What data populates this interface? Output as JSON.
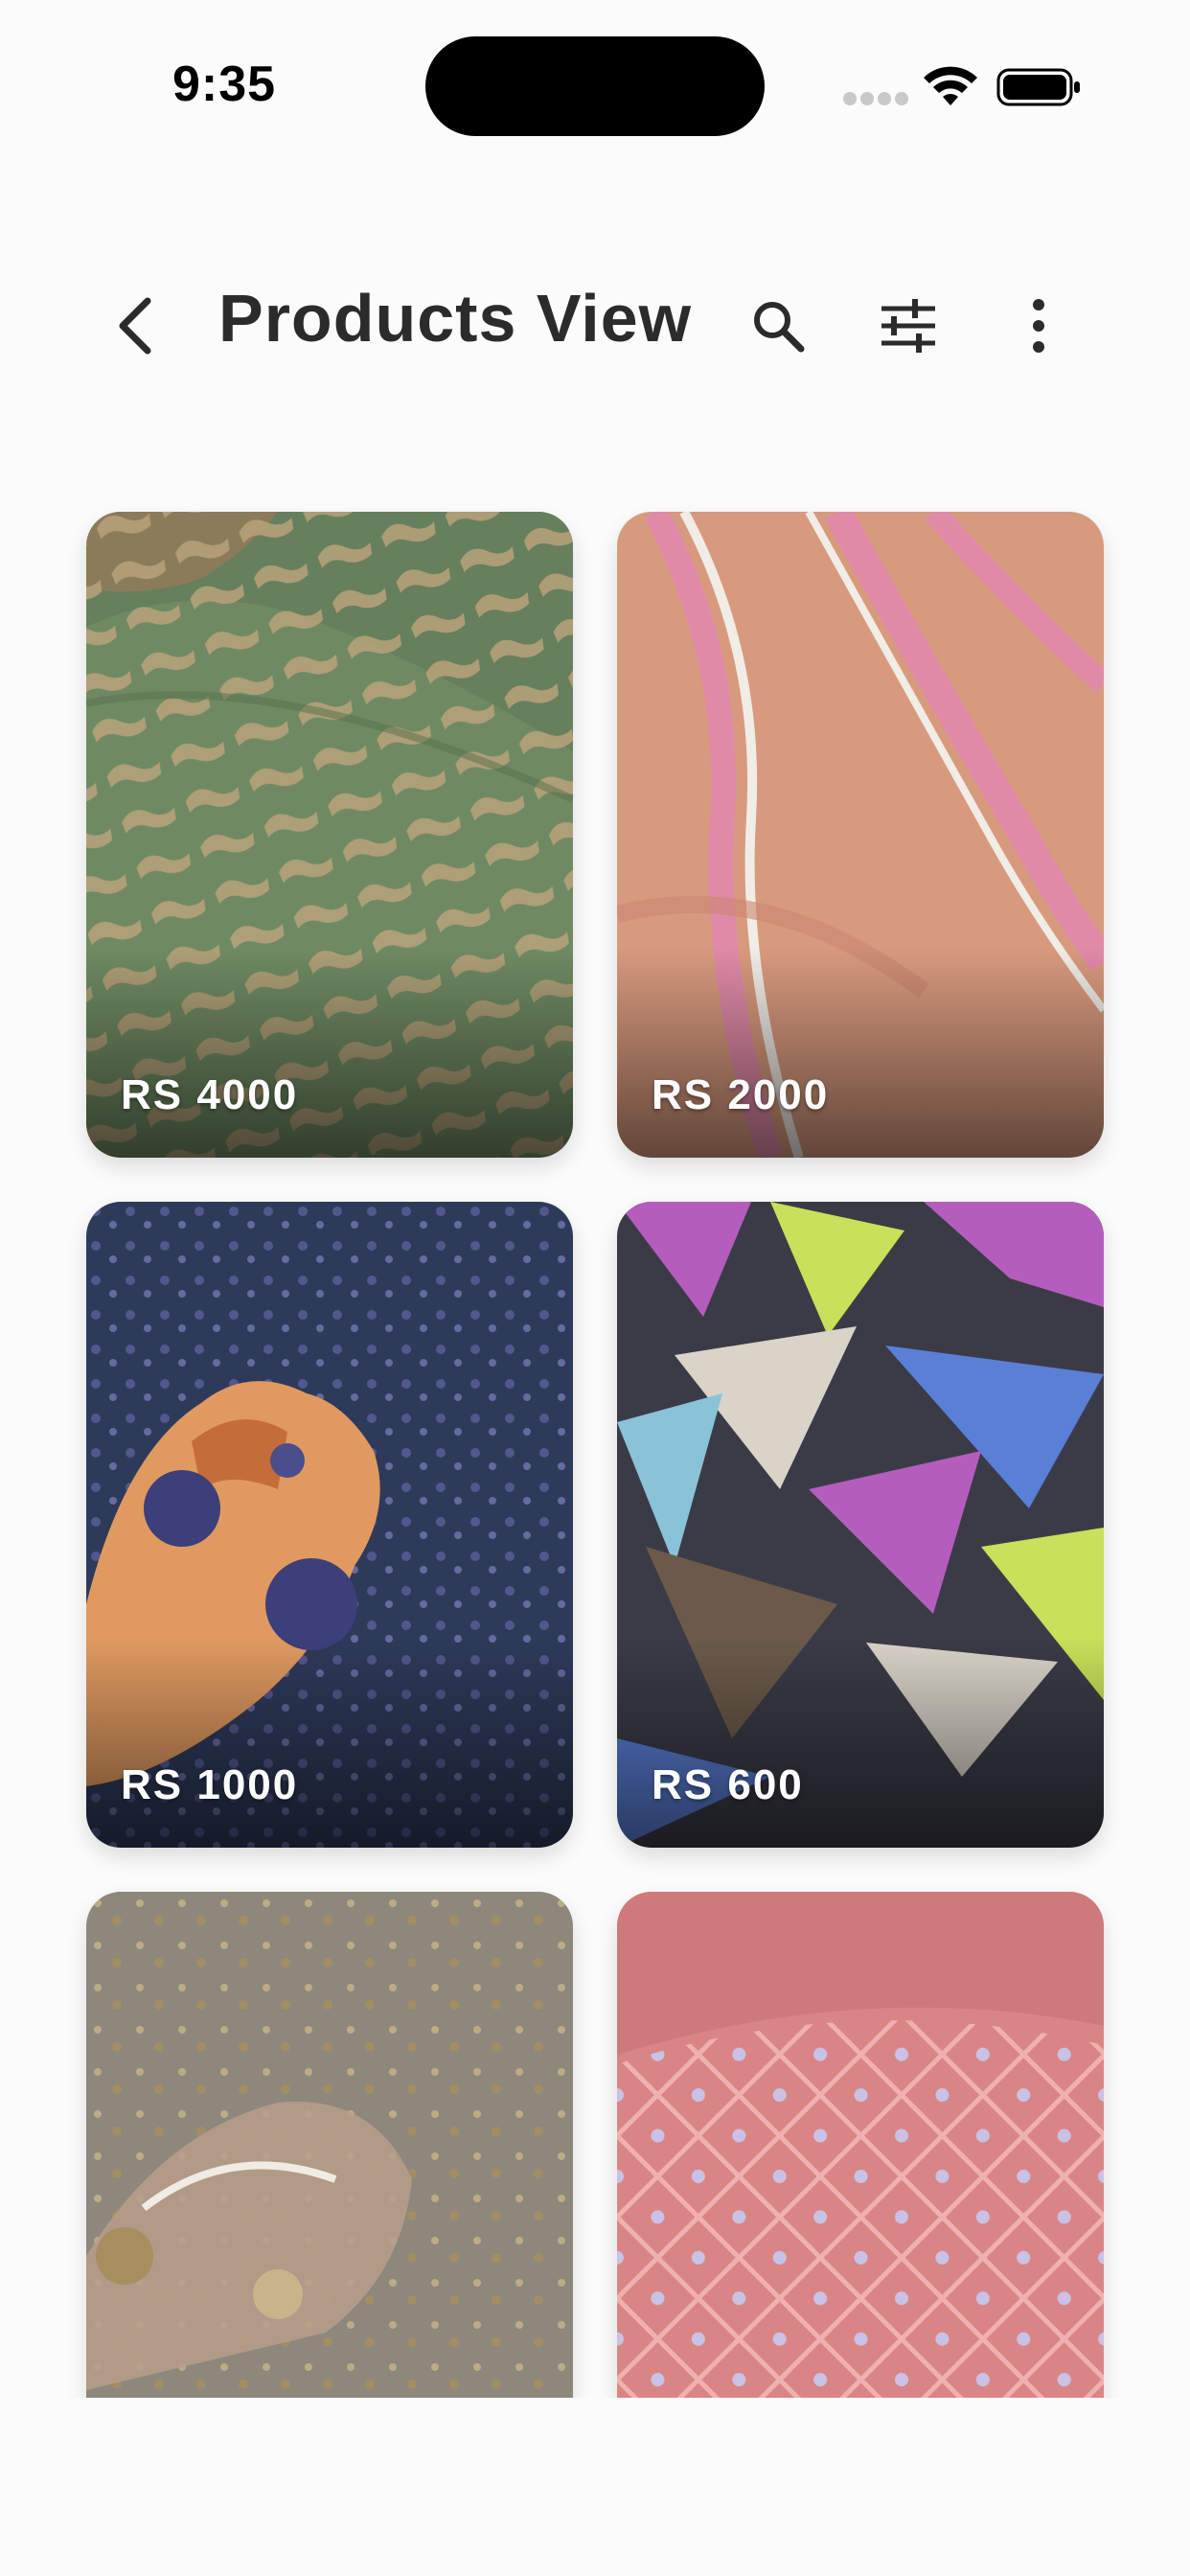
{
  "status_bar": {
    "time": "9:35",
    "icons": [
      "signal-icon",
      "wifi-icon",
      "battery-icon"
    ]
  },
  "header": {
    "title": "Products View",
    "icons": [
      "back-icon",
      "search-icon",
      "filter-icon",
      "more-vert-icon"
    ]
  },
  "products": [
    {
      "price": "RS 4000",
      "base": "#6f8a63",
      "accent": "#b8a27a"
    },
    {
      "price": "RS 2000",
      "base": "#d89a7e",
      "accent": "#e08aa8"
    },
    {
      "price": "RS 1000",
      "base": "#2e3a5a",
      "accent": "#5b5f9a"
    },
    {
      "price": "RS 600",
      "base": "#3b3b48",
      "accent": "#b45dbd"
    },
    {
      "price": "",
      "base": "#8d877c",
      "accent": "#c8b48a"
    },
    {
      "price": "",
      "base": "#d98585",
      "accent": "#f0b0b0"
    }
  ],
  "colors": {
    "title": "#2b2b2b",
    "background": "#fbfbfb",
    "price_text": "#ffffff"
  }
}
